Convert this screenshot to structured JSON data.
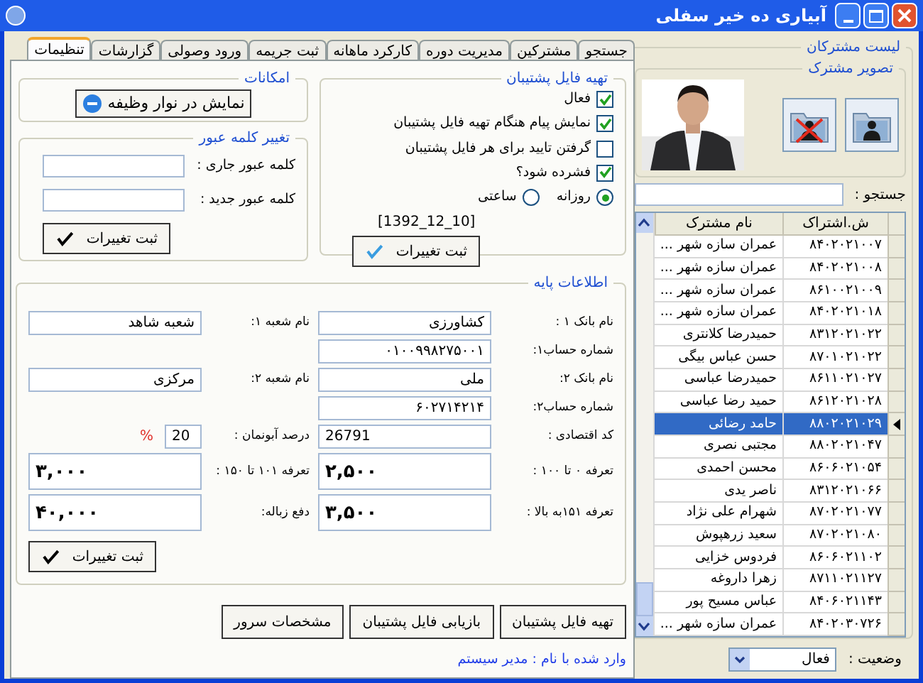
{
  "window": {
    "title": "آبیاری ده خیر سفلی"
  },
  "tabs": [
    {
      "label": "جستجو",
      "selected": false
    },
    {
      "label": "مشترکین",
      "selected": false
    },
    {
      "label": "مدیریت دوره",
      "selected": false
    },
    {
      "label": "کارکرد ماهانه",
      "selected": false
    },
    {
      "label": "ثبت جریمه",
      "selected": false
    },
    {
      "label": "ورود وصولی",
      "selected": false
    },
    {
      "label": "گزارشات",
      "selected": false
    },
    {
      "label": "تنظیمات",
      "selected": true
    }
  ],
  "backup": {
    "title": "تهیه فایل پشتیبان",
    "options": [
      {
        "label": "فعال",
        "checked": true
      },
      {
        "label": "نمایش پیام هنگام تهیه فایل پشتیبان",
        "checked": true
      },
      {
        "label": "گرفتن تایید برای هر فایل پشتیبان",
        "checked": false
      },
      {
        "label": "فشرده شود؟",
        "checked": true
      }
    ],
    "frequency": [
      {
        "label": "روزانه",
        "selected": true
      },
      {
        "label": "ساعتی",
        "selected": false
      }
    ],
    "last_date": "[1392_12_10]",
    "save_button": "ثبت تغییرات"
  },
  "features": {
    "title": "امکانات",
    "button": "نمایش در نوار وظیفه"
  },
  "password": {
    "title": "تغییر کلمه عبور",
    "fields": [
      {
        "label": "کلمه عبور جاری :"
      },
      {
        "label": "کلمه عبور جدید :"
      }
    ],
    "save_button": "ثبت تغییرات"
  },
  "base_info": {
    "title": "اطلاعات پایه",
    "rows": [
      [
        {
          "label": "نام بانک ۱ :",
          "value": "کشاورزی",
          "kind": "text"
        },
        {
          "label": "نام شعبه ۱:",
          "value": "شعبه شاهد",
          "kind": "text"
        }
      ],
      [
        {
          "label": "شماره حساب۱:",
          "value": "۰۱۰۰۹۹۸۲۷۵۰۰۱",
          "kind": "text"
        }
      ],
      [
        {
          "label": "نام بانک ۲:",
          "value": "ملی",
          "kind": "text"
        },
        {
          "label": "نام شعبه ۲:",
          "value": "مرکزی",
          "kind": "text"
        }
      ],
      [
        {
          "label": "شماره حساب۲:",
          "value": "۶۰۲۷۱۴۲۱۴",
          "kind": "text"
        }
      ],
      [
        {
          "label": "کد اقتصادی :",
          "value": "26791",
          "kind": "number"
        },
        {
          "label": "درصد آبونمان :",
          "value": "20",
          "unit": "%",
          "kind": "percent"
        }
      ],
      [
        {
          "label": "تعرفه ۰ تا ۱۰۰ :",
          "value": "۲,۵۰۰",
          "kind": "tariff"
        },
        {
          "label": "تعرفه ۱۰۱ تا ۱۵۰ :",
          "value": "۳,۰۰۰",
          "kind": "tariff"
        }
      ],
      [
        {
          "label": "تعرفه ۱۵۱به بالا :",
          "value": "۳,۵۰۰",
          "kind": "tariff"
        },
        {
          "label": "دفع زباله:",
          "value": "۴۰,۰۰۰",
          "kind": "tariff"
        }
      ]
    ],
    "save_button": "ثبت تغییرات"
  },
  "actions": [
    "تهیه فایل پشتیبان",
    "بازیابی فایل پشتیبان",
    "مشخصات سرور"
  ],
  "login_status": "وارد شده با نام : مدیر سیستم",
  "subscribers": {
    "title": "لیست مشترکان",
    "photo_title": "تصویر مشترک",
    "search_label": "جستجو :",
    "columns": [
      "ش.اشتراک",
      "نام مشترک"
    ],
    "rows": [
      {
        "id": "۸۴۰۲۰۲۱۰۰۷",
        "name": "عمران سازه شهر ...",
        "selected": false
      },
      {
        "id": "۸۴۰۲۰۲۱۰۰۸",
        "name": "عمران سازه شهر ...",
        "selected": false
      },
      {
        "id": "۸۶۱۰۰۲۱۰۰۹",
        "name": "عمران سازه شهر ...",
        "selected": false
      },
      {
        "id": "۸۴۰۲۰۲۱۰۱۸",
        "name": "عمران سازه شهر ...",
        "selected": false
      },
      {
        "id": "۸۳۱۲۰۲۱۰۲۲",
        "name": "حمیدرضا کلانتری",
        "selected": false
      },
      {
        "id": "۸۷۰۱۰۲۱۰۲۲",
        "name": "حسن  عباس بیگی",
        "selected": false
      },
      {
        "id": "۸۶۱۱۰۲۱۰۲۷",
        "name": "حمیدرضا عباسی",
        "selected": false
      },
      {
        "id": "۸۶۱۲۰۲۱۰۲۸",
        "name": "حمید رضا عباسی",
        "selected": false
      },
      {
        "id": "۸۸۰۲۰۲۱۰۲۹",
        "name": "حامد رضائی",
        "selected": true
      },
      {
        "id": "۸۸۰۲۰۲۱۰۴۷",
        "name": "مجتبی نصری",
        "selected": false
      },
      {
        "id": "۸۶۰۶۰۲۱۰۵۴",
        "name": "محسن احمدی",
        "selected": false
      },
      {
        "id": "۸۳۱۲۰۲۱۰۶۶",
        "name": "ناصر یدی",
        "selected": false
      },
      {
        "id": "۸۷۰۲۰۲۱۰۷۷",
        "name": "شهرام علی نژاد",
        "selected": false
      },
      {
        "id": "۸۷۰۲۰۲۱۰۸۰",
        "name": "سعید زرهپوش",
        "selected": false
      },
      {
        "id": "۸۶۰۶۰۲۱۱۰۲",
        "name": "فردوس خزایی",
        "selected": false
      },
      {
        "id": "۸۷۱۱۰۲۱۱۲۷",
        "name": "زهرا داروغه",
        "selected": false
      },
      {
        "id": "۸۴۰۶۰۲۱۱۴۳",
        "name": "عباس مسیح پور",
        "selected": false
      },
      {
        "id": "۸۴۰۲۰۳۰۷۲۶",
        "name": "عمران سازه شهر ...",
        "selected": false
      }
    ],
    "status_label": "وضعیت :",
    "status_value": "فعال"
  }
}
